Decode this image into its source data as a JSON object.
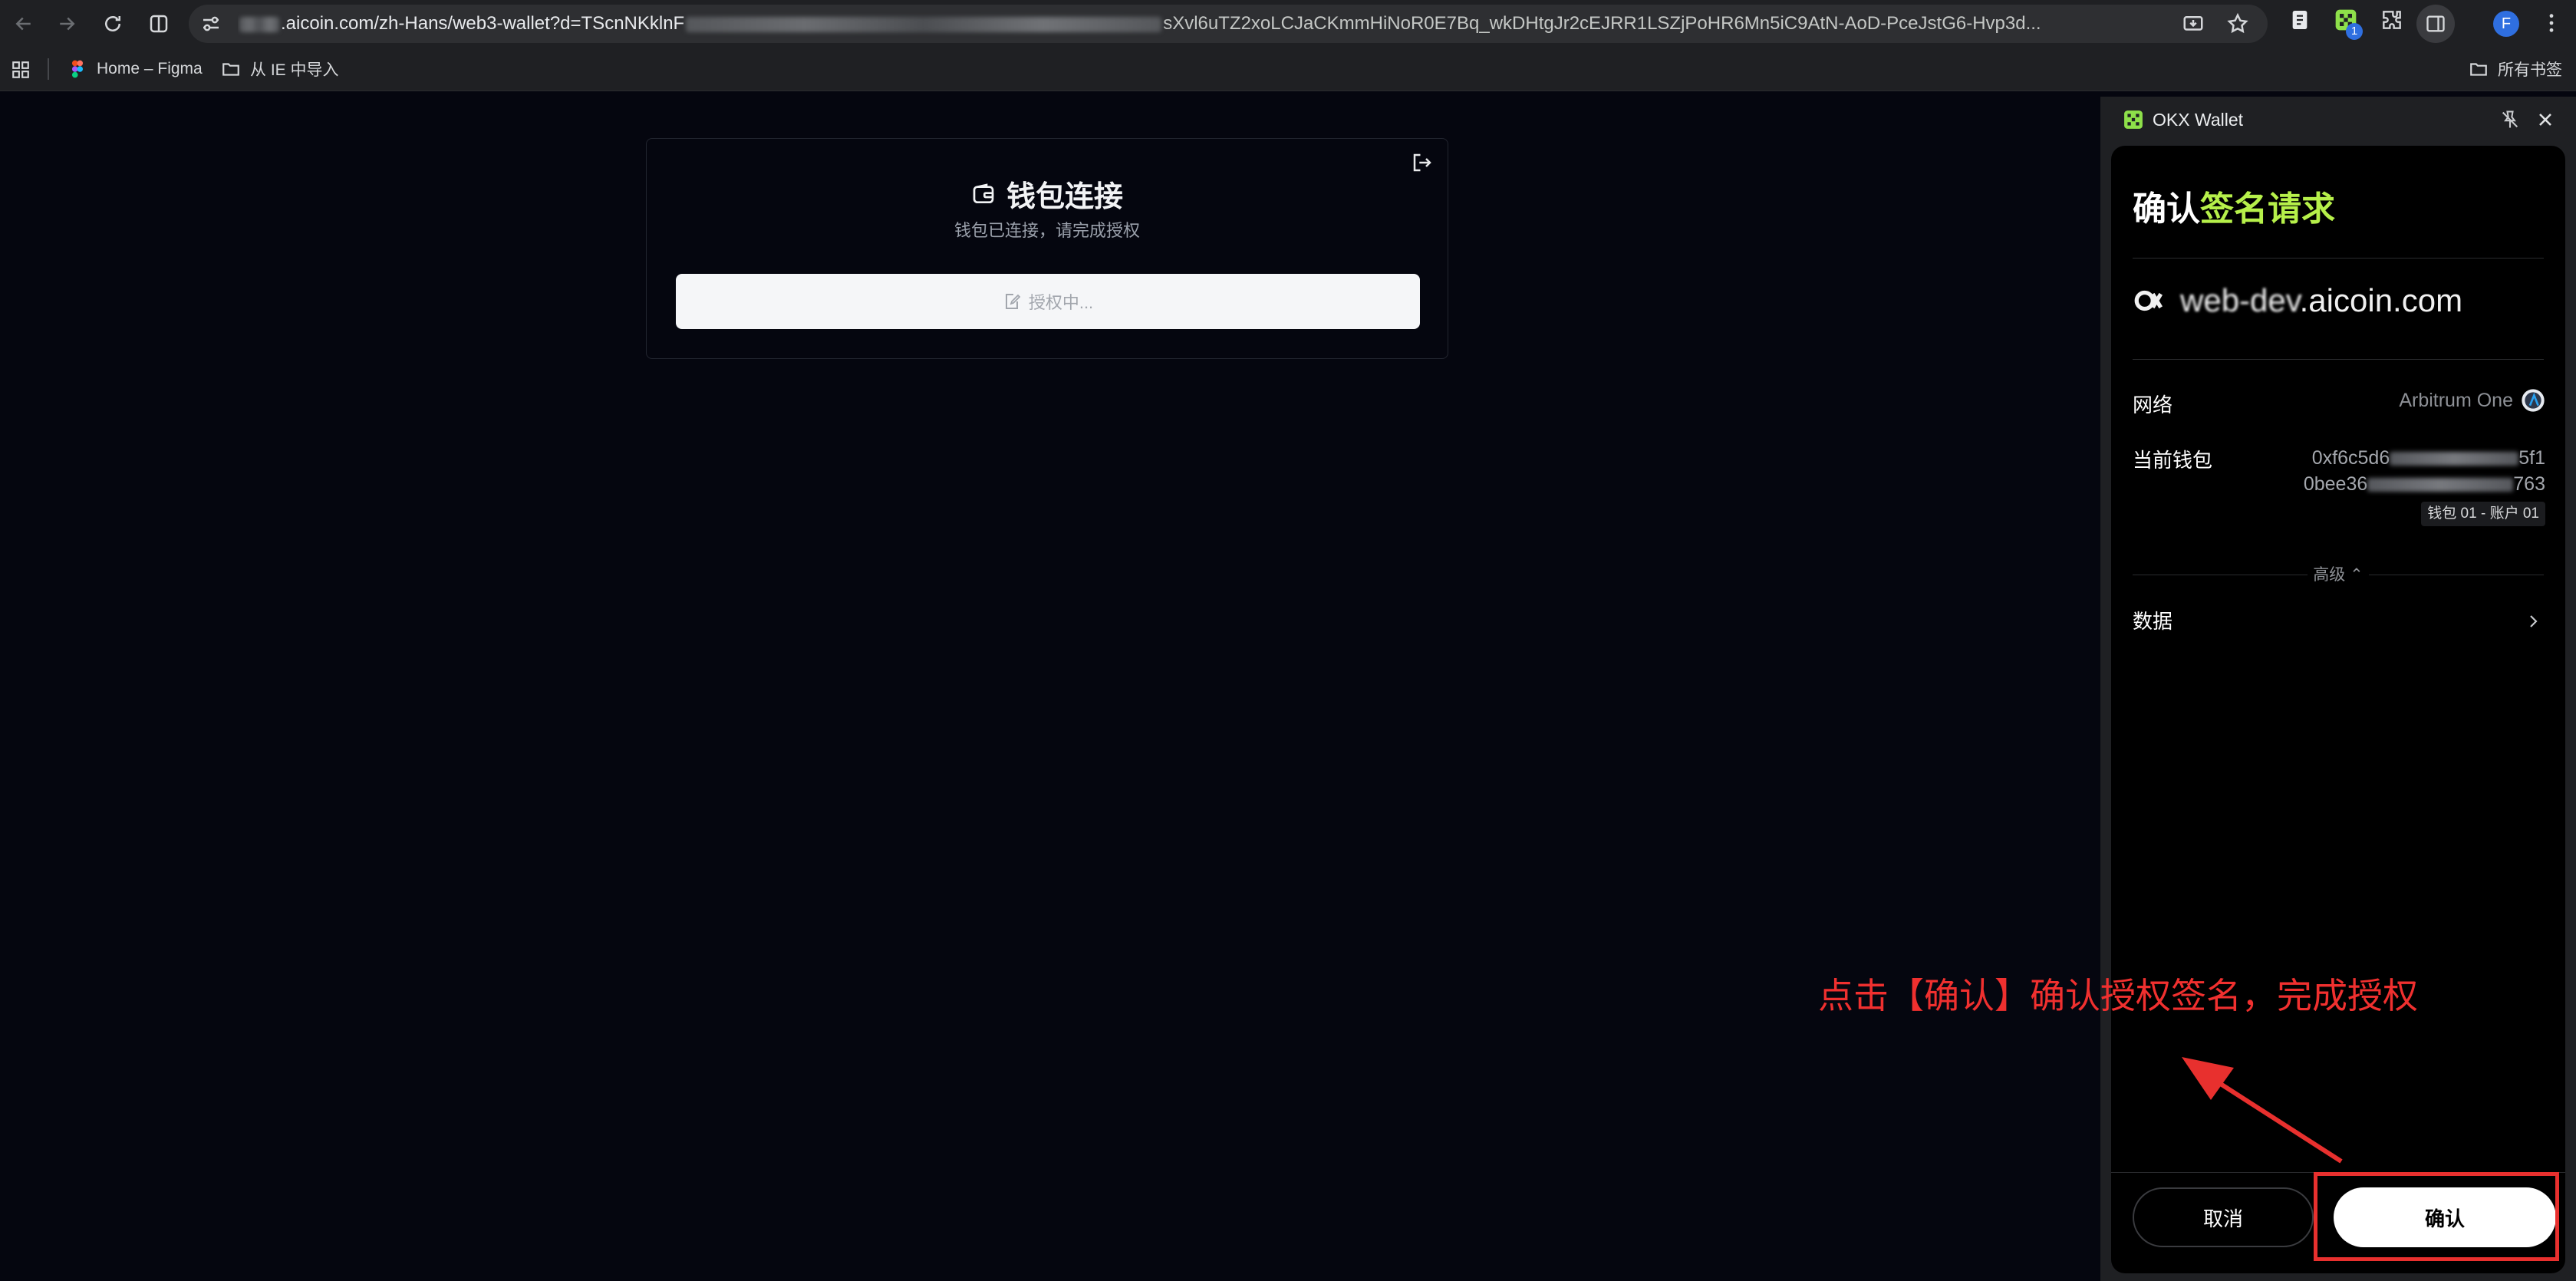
{
  "browser": {
    "url_prefix": "w",
    "url_host": ".aicoin.com/zh-Hans/web3-wallet?d=TScnNKklnF",
    "url_suffix": "sXvl6uTZ2xoLCJaCKmmHiNoR0E7Bq_wkDHtgJr2cEJRR1LSZjPoHR6Mn5iC9AtN-AoD-PceJstG6-Hvp3d...",
    "extension_badge": "1",
    "profile_initial": "F",
    "bookmarks": [
      {
        "label": "Home – Figma",
        "icon": "figma-icon"
      },
      {
        "label": "从 IE 中导入",
        "icon": "folder-icon"
      }
    ],
    "all_bookmarks_label": "所有书签"
  },
  "page": {
    "card": {
      "title": "钱包连接",
      "subtitle": "钱包已连接，请完成授权",
      "button_label": "授权中..."
    }
  },
  "side_panel": {
    "title": "OKX Wallet",
    "heading_plain": "确认",
    "heading_accent": "签名请求",
    "site_domain_blurred": "web-dev",
    "site_domain": ".aicoin.com",
    "network_label": "网络",
    "network_value": "Arbitrum One",
    "wallet_label": "当前钱包",
    "address_line1_start": "0xf6c5d6",
    "address_line1_end": "5f1",
    "address_line2_start": "0bee36",
    "address_line2_end": "763",
    "wallet_tag": "钱包 01 - 账户 01",
    "advanced_label": "高级 ⌃",
    "data_label": "数据",
    "cancel_label": "取消",
    "confirm_label": "确认"
  },
  "annotation": {
    "text": "点击【确认】确认授权签名，完成授权"
  },
  "colors": {
    "page_bg": "#05060f",
    "accent_green": "#b6f04a",
    "annotation_red": "#e8302e"
  }
}
